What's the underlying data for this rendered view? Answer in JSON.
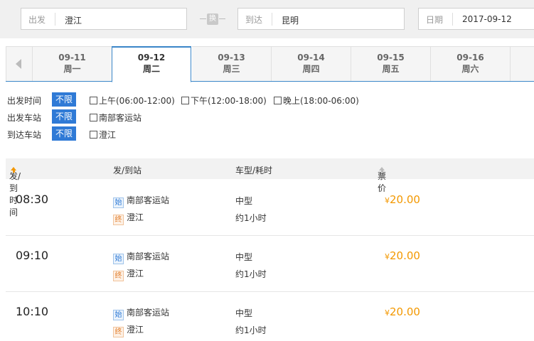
{
  "search": {
    "from_label": "出发",
    "from_value": "澄江",
    "swap_label": "换",
    "to_label": "到达",
    "to_value": "昆明",
    "date_label": "日期",
    "date_value": "2017-09-12"
  },
  "date_tabs": [
    {
      "date": "09-11",
      "weekday": "周一"
    },
    {
      "date": "09-12",
      "weekday": "周二",
      "active": true
    },
    {
      "date": "09-13",
      "weekday": "周三"
    },
    {
      "date": "09-14",
      "weekday": "周四"
    },
    {
      "date": "09-15",
      "weekday": "周五"
    },
    {
      "date": "09-16",
      "weekday": "周六"
    }
  ],
  "filters": [
    {
      "label": "出发时间",
      "badge": "不限",
      "options": [
        "上午(06:00-12:00)",
        "下午(12:00-18:00)",
        "晚上(18:00-06:00)"
      ]
    },
    {
      "label": "出发车站",
      "badge": "不限",
      "options": [
        "南部客运站"
      ]
    },
    {
      "label": "到达车站",
      "badge": "不限",
      "options": [
        "澄江"
      ]
    }
  ],
  "table": {
    "headers": {
      "time": "发/到时间",
      "stations": "发/到站",
      "type": "车型/耗时",
      "price": "票价"
    },
    "rows": [
      {
        "time": "08:30",
        "start_icon": "始",
        "from": "南部客运站",
        "end_icon": "终",
        "to": "澄江",
        "bus": "中型",
        "duration": "约1小时",
        "currency": "¥",
        "price": "20.00"
      },
      {
        "time": "09:10",
        "start_icon": "始",
        "from": "南部客运站",
        "end_icon": "终",
        "to": "澄江",
        "bus": "中型",
        "duration": "约1小时",
        "currency": "¥",
        "price": "20.00"
      },
      {
        "time": "10:10",
        "start_icon": "始",
        "from": "南部客运站",
        "end_icon": "终",
        "to": "澄江",
        "bus": "中型",
        "duration": "约1小时",
        "currency": "¥",
        "price": "20.00"
      }
    ]
  },
  "colors": {
    "accent": "#2f7ad6",
    "price": "#f39800",
    "tab_border": "#3a86c8"
  }
}
